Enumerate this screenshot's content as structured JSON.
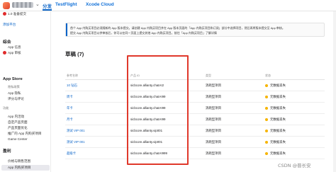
{
  "topbar": {
    "tabs": [
      {
        "label": "分发",
        "active": true
      },
      {
        "label": "TestFlight",
        "active": false
      },
      {
        "label": "Xcode Cloud",
        "active": false
      }
    ]
  },
  "sidebar": {
    "app_status": "1.0 准备提交",
    "add_platform": "添加平台",
    "general_heading": "综合",
    "general_items": [
      "App 信息",
      "App 审核"
    ],
    "app_store_heading": "App Store",
    "app_store_items": [
      "隐私政策",
      "App 隐私",
      "评分与评论"
    ],
    "features_heading": "功能",
    "features_items": [
      "App 内活动",
      "自定产品页面",
      "产品页面优化",
      "推广的 App 内购买项目",
      "Game Center"
    ],
    "monetization_heading": "盈利",
    "monetization_items": [
      "价格与销售范围",
      "App 内购买项目"
    ],
    "selected_item": "App 内购买项目"
  },
  "banner": {
    "line1": "首个 App 内购买项目必须随新的 App 版本提交。请创建 App 内购买项目并在 App 版本页面的「App 内购买项目和订阅」部分中选择项目，然后再将版本提交至 App 审核。",
    "line2": "提交 App 内购买项目以供审核后，你可以在同一页面上提交其他 App 内购买项目。前往「App 内购买项目」了解详情"
  },
  "section": {
    "title": "草稿 (7)"
  },
  "table": {
    "headers": [
      "参考名称",
      "产品 ID",
      "类型",
      "状态"
    ],
    "rows": [
      {
        "name": "10 钻石",
        "product_id": "sicbcore.allianty.chatAI2",
        "type": "消耗型项目",
        "status": "元数据丢失"
      },
      {
        "name": "周卡",
        "product_id": "sicbcore.allianty.chatAI99",
        "type": "消耗型项目",
        "status": "元数据丢失"
      },
      {
        "name": "年卡",
        "product_id": "sicbcore.allianty.chatAI99",
        "type": "消耗型项目",
        "status": "元数据丢失"
      },
      {
        "name": "月卡",
        "product_id": "sicbcore.allianty.chatAI99",
        "type": "消耗型项目",
        "status": "元数据丢失"
      },
      {
        "name": "测试 VIP 001",
        "product_id": "sicbcore.allianty.vip001",
        "type": "消耗型项目",
        "status": "元数据丢失"
      },
      {
        "name": "测试 VIP 001",
        "product_id": "sicbcore.allianty.vip001",
        "type": "消耗型项目",
        "status": "元数据丢失"
      },
      {
        "name": "超级卡",
        "product_id": "sicbcore.allianty.chatAI999",
        "type": "消耗型项目",
        "status": "元数据丢失"
      }
    ]
  },
  "watermark": "CSDN @晋长安",
  "colors": {
    "accent": "#0a64c8",
    "alert": "#e02b2b",
    "status": "#f6b400",
    "highlight_box": "#e0382b"
  }
}
